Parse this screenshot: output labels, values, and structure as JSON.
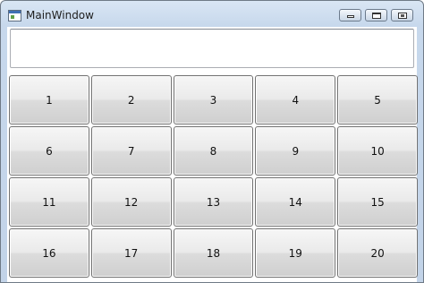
{
  "window": {
    "title": "MainWindow",
    "controls": [
      "minimize",
      "maximize",
      "close"
    ]
  },
  "display": {
    "value": ""
  },
  "buttons": [
    "1",
    "2",
    "3",
    "4",
    "5",
    "6",
    "7",
    "8",
    "9",
    "10",
    "11",
    "12",
    "13",
    "14",
    "15",
    "16",
    "17",
    "18",
    "19",
    "20"
  ],
  "icons": {
    "app": "app-window-icon",
    "minimize": "minimize-icon",
    "maximize": "maximize-icon",
    "close": "close-icon"
  }
}
